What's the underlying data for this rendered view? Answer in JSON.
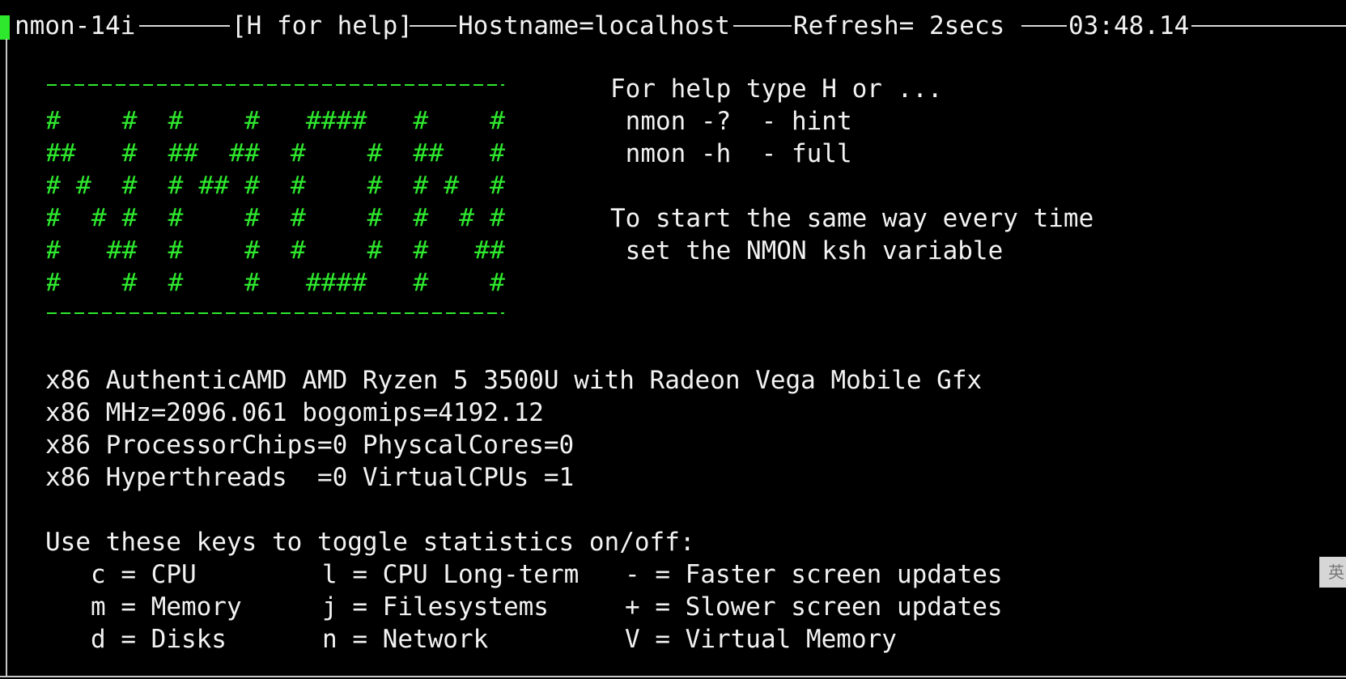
{
  "header": {
    "app": "nmon-14i",
    "help": "[H for help]",
    "hostname": "Hostname=localhost",
    "refresh": "Refresh= 2secs",
    "time": "03:48.14"
  },
  "logo_rows": [
    "#    #  #    #   ####   #    #",
    "##   #  ##  ##  #    #  ##   #",
    "# #  #  # ## #  #    #  # #  #",
    "#  # #  #    #  #    #  #  # #",
    "#   ##  #    #  #    #  #   ##",
    "#    #  #    #   ####   #    #"
  ],
  "help_text": [
    "For help type H or ...",
    " nmon -?  - hint",
    " nmon -h  - full",
    "",
    "To start the same way every time",
    " set the NMON ksh variable"
  ],
  "cpu_info": [
    "x86 AuthenticAMD AMD Ryzen 5 3500U with Radeon Vega Mobile Gfx",
    "x86 MHz=2096.061 bogomips=4192.12",
    "x86 ProcessorChips=0 PhyscalCores=0",
    "x86 Hyperthreads  =0 VirtualCPUs =1"
  ],
  "keys_title": "Use these keys to toggle statistics on/off:",
  "key_rows": [
    [
      "c = CPU",
      "l = CPU Long-term",
      "- = Faster screen updates"
    ],
    [
      "m = Memory",
      "j = Filesystems",
      "+ = Slower screen updates"
    ],
    [
      "d = Disks",
      "n = Network",
      "V = Virtual Memory"
    ]
  ],
  "ime_badge": "英",
  "colors": {
    "logo": "#2ee82e",
    "cursor": "#2ee82e",
    "text": "#f2f2f2",
    "background": "#000000"
  }
}
